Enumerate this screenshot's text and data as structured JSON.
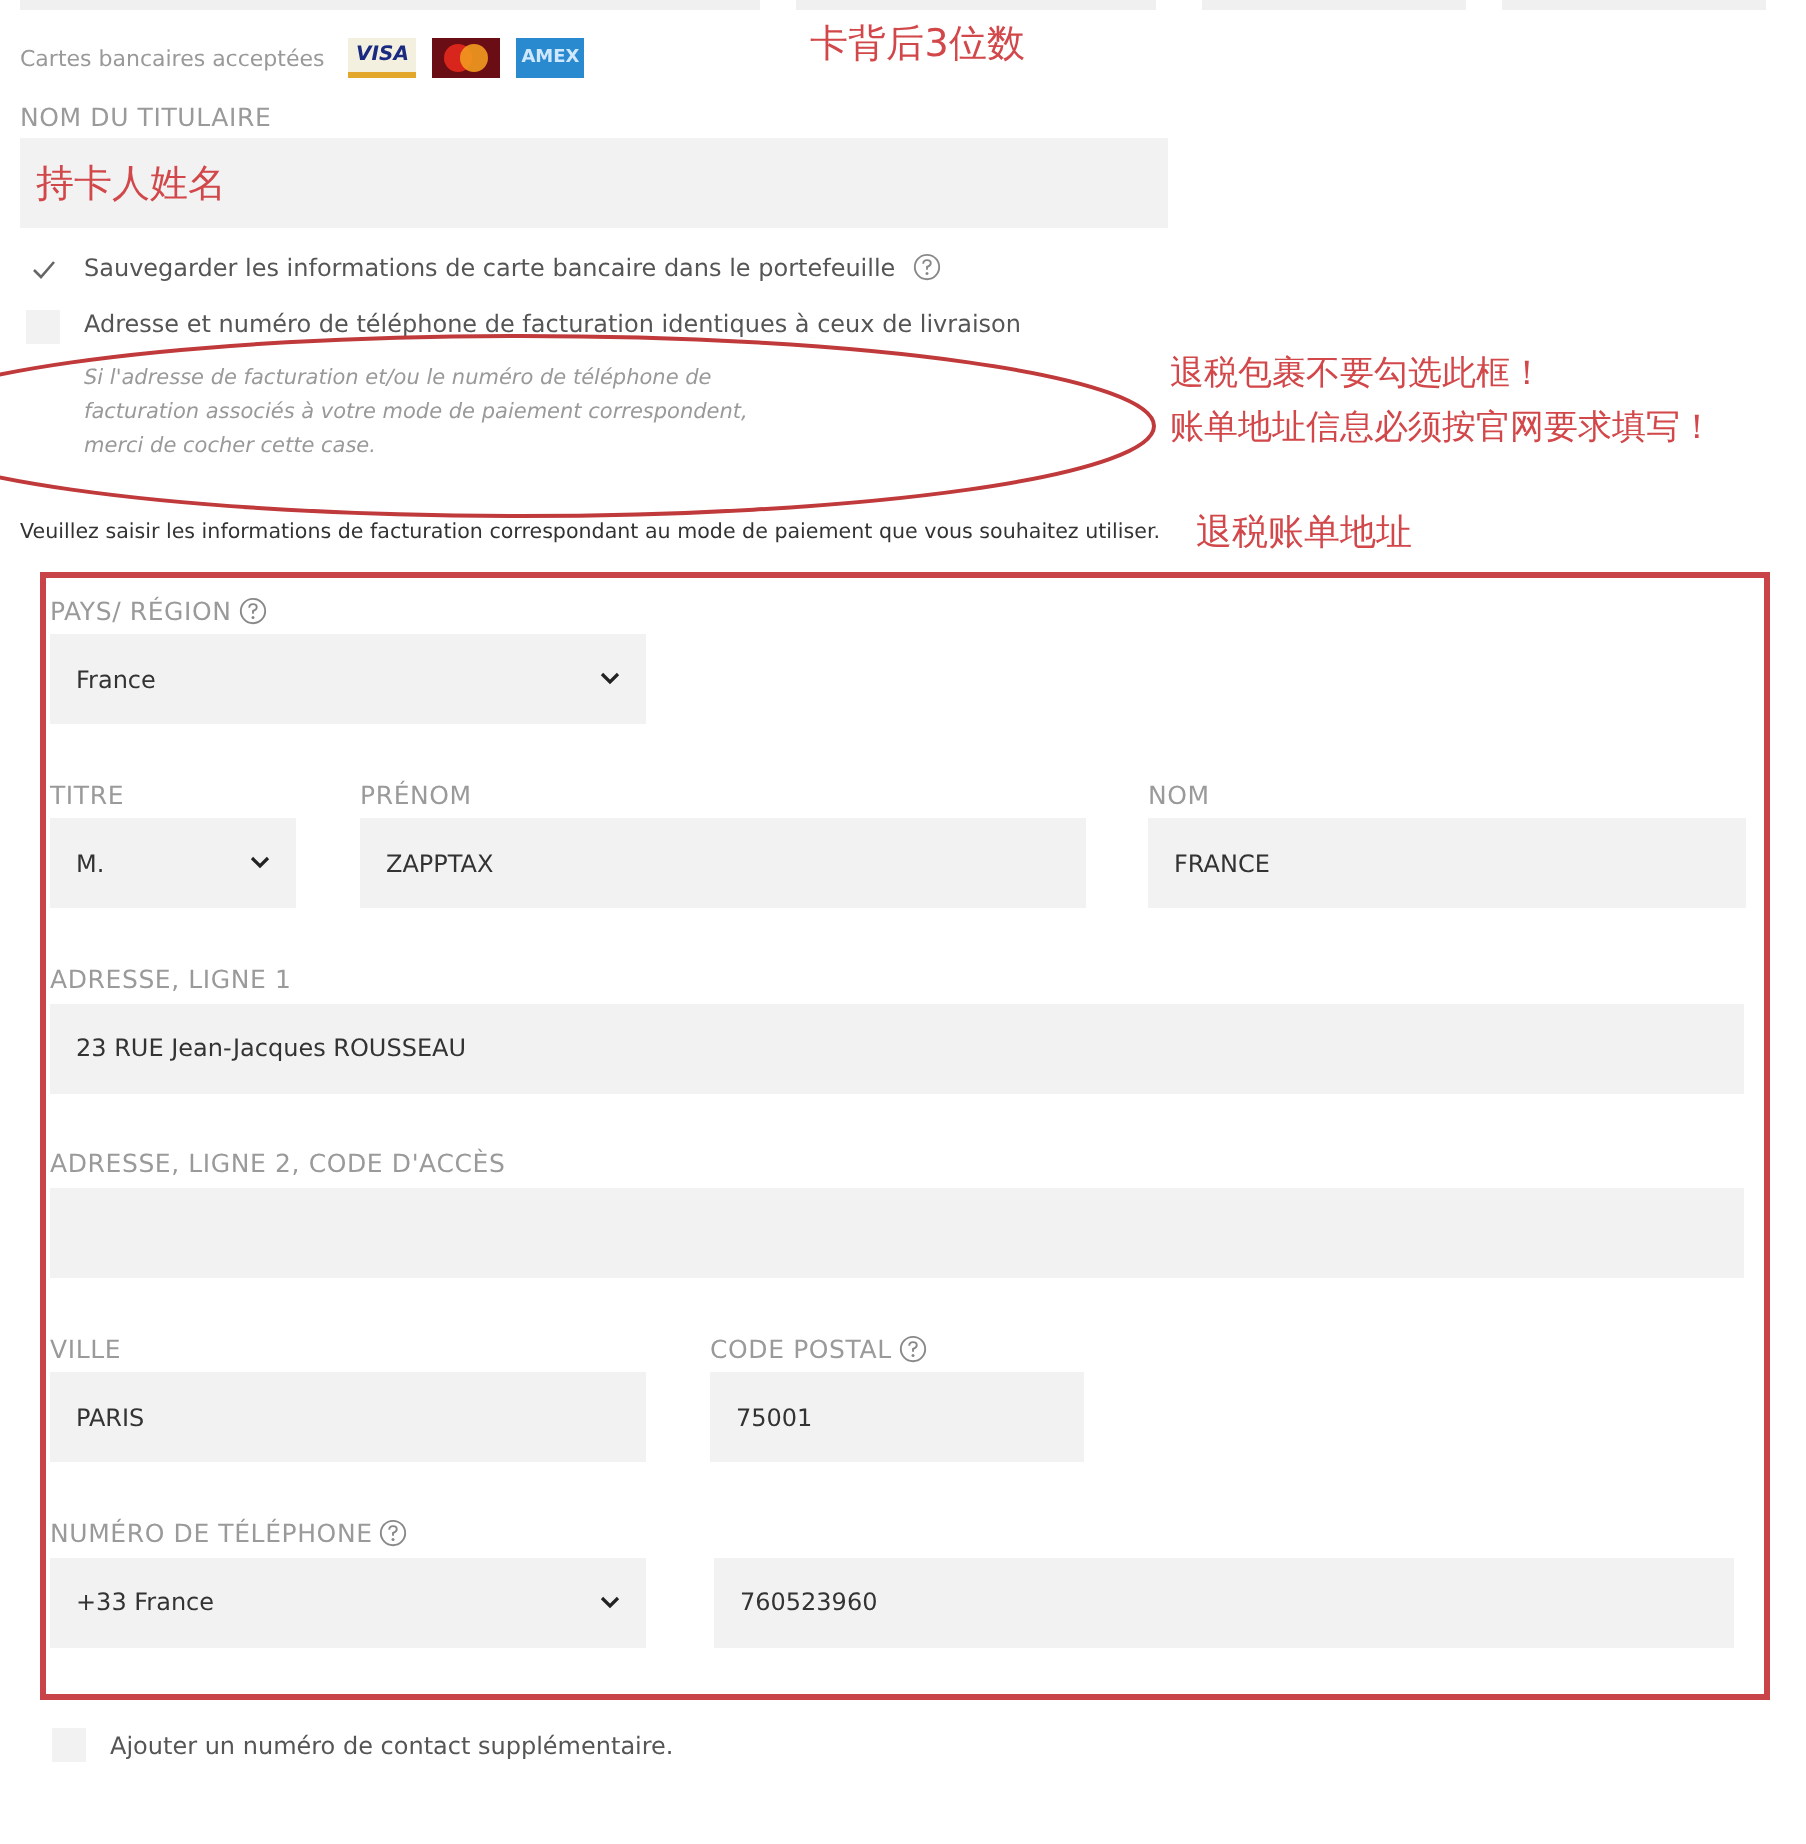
{
  "cards": {
    "label": "Cartes bancaires acceptées",
    "logos": [
      {
        "kind": "visa",
        "text": "VISA"
      },
      {
        "kind": "mastercard"
      },
      {
        "kind": "amex",
        "text": "AMEX"
      }
    ]
  },
  "cvv_note": "卡背后3位数",
  "holder": {
    "label": "NOM DU TITULAIRE",
    "value": "持卡人姓名"
  },
  "checkboxes": [
    {
      "label": "Sauvegarder les informations de carte bancaire dans le portefeuille",
      "checked": true,
      "help": true
    },
    {
      "label": "Adresse et numéro de téléphone de facturation identiques à ceux de livraison",
      "checked": false,
      "help": false,
      "note": "Si l'adresse de facturation et/ou le numéro de téléphone de facturation associés à votre mode de paiement correspondent, merci de cocher cette case."
    }
  ],
  "warning_notes": [
    "退税包裹不要勾选此框！",
    "账单地址信息必须按官网要求填写！"
  ],
  "intro": "Veuillez saisir les informations de facturation correspondant au mode de paiement que vous souhaitez utiliser.",
  "billing_note": "退税账单地址",
  "billing_rows": [
    [
      {
        "kind": "select",
        "label": "PAYS/ RÉGION",
        "help": true,
        "value": "France"
      }
    ],
    [
      {
        "kind": "select",
        "label": "TITRE",
        "help": false,
        "value": "M."
      },
      {
        "kind": "input",
        "label": "PRÉNOM",
        "help": false,
        "value": "ZAPPTAX"
      },
      {
        "kind": "input",
        "label": "NOM",
        "help": false,
        "value": "FRANCE"
      }
    ],
    [
      {
        "kind": "input",
        "label": "ADRESSE, LIGNE 1",
        "help": false,
        "value": "23 RUE Jean-Jacques ROUSSEAU"
      }
    ],
    [
      {
        "kind": "input",
        "label": "ADRESSE, LIGNE 2, CODE D'ACCÈS",
        "help": false
      }
    ],
    [
      {
        "kind": "input",
        "label": "VILLE",
        "help": false,
        "value": "PARIS"
      },
      {
        "kind": "input",
        "label": "CODE POSTAL",
        "help": true,
        "value": "75001"
      }
    ],
    [
      {
        "kind": "select",
        "label": "NUMÉRO DE TÉLÉPHONE",
        "help": true,
        "value": "+33 France"
      },
      {
        "kind": "input",
        "value": "760523960"
      }
    ]
  ],
  "extra_contact": {
    "label": "Ajouter un numéro de contact supplémentaire.",
    "checked": false
  }
}
